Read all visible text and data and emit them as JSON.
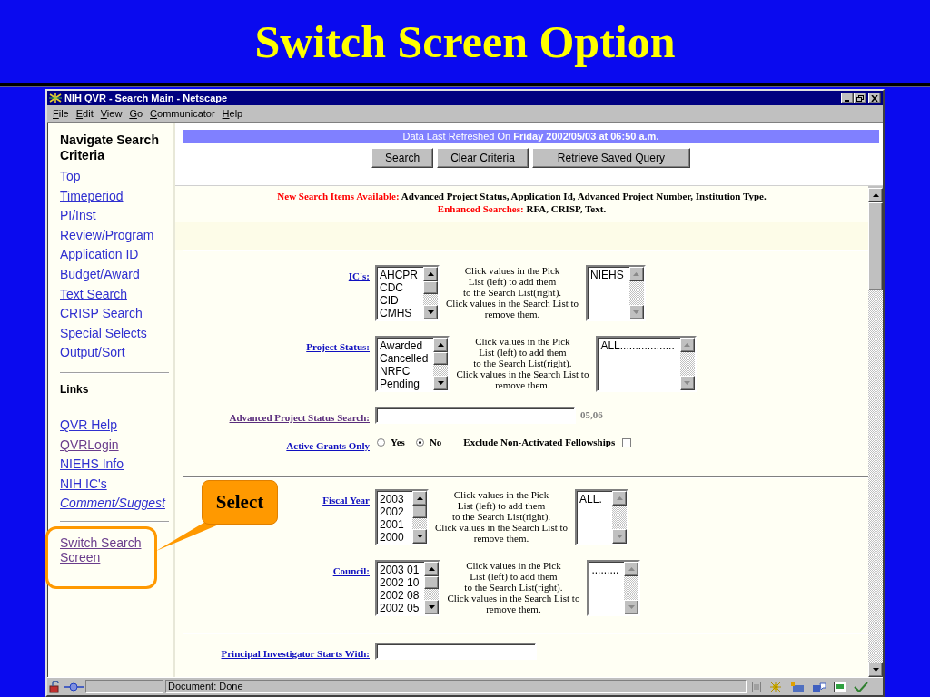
{
  "slide": {
    "title": "Switch Screen Option"
  },
  "window": {
    "title": "NIH QVR - Search Main - Netscape"
  },
  "menu": [
    {
      "label": "File"
    },
    {
      "label": "Edit"
    },
    {
      "label": "View"
    },
    {
      "label": "Go"
    },
    {
      "label": "Communicator"
    },
    {
      "label": "Help"
    }
  ],
  "sidebar": {
    "heading": "Navigate Search Criteria",
    "nav_links": [
      {
        "label": "Top",
        "visited": false
      },
      {
        "label": "Timeperiod",
        "visited": false
      },
      {
        "label": "PI/Inst",
        "visited": false
      },
      {
        "label": "Review/Program",
        "visited": false
      },
      {
        "label": "Application ID",
        "visited": false
      },
      {
        "label": "Budget/Award",
        "visited": false
      },
      {
        "label": "Text Search",
        "visited": false
      },
      {
        "label": "CRISP Search",
        "visited": false
      },
      {
        "label": "Special Selects",
        "visited": false
      },
      {
        "label": "Output/Sort",
        "visited": false
      }
    ],
    "links_heading": "Links",
    "links": [
      {
        "label": "QVR Help",
        "visited": false,
        "italic": false
      },
      {
        "label": "QVRLogin",
        "visited": true,
        "italic": false
      },
      {
        "label": "NIEHS Info",
        "visited": false,
        "italic": false
      },
      {
        "label": "NIH IC's",
        "visited": false,
        "italic": false
      },
      {
        "label": "Comment/Suggest",
        "visited": false,
        "italic": true
      }
    ],
    "switch_link": {
      "label": "Switch Search Screen",
      "visited": true
    }
  },
  "refresh_bar": {
    "text": "Data Last Refreshed On **Friday 2002/05/03 at 06:50 a.m.**"
  },
  "buttons": [
    "Search",
    "Clear Criteria",
    "Retrieve Saved Query"
  ],
  "notices": [
    {
      "label": "New Search Items Available:",
      "text": "Advanced Project Status, Application Id, Advanced Project Number, Institution Type."
    },
    {
      "label": "Enhanced Searches:",
      "text": "RFA, CRISP, Text."
    }
  ],
  "form": {
    "sections": [
      {
        "rows": [
          {
            "kind": "picklist",
            "label": "IC's:",
            "visited": false,
            "pick_list": [
              "AHCPR",
              "CDC",
              "CID",
              "CMHS"
            ],
            "help": "Click values in the Pick\nList (left) to add them\nto the Search List(right).\nClick values in the Search List to\nremove them.",
            "search_list": [
              "NIEHS"
            ]
          },
          {
            "kind": "picklist",
            "label": "Project Status:",
            "visited": false,
            "pick_list": [
              "Awarded",
              "Cancelled",
              "NRFC",
              "Pending"
            ],
            "help": "Click values in the Pick\nList (left) to add them\nto the Search List(right).\nClick values in the Search List to\nremove them.",
            "search_list": [
              "ALL.................."
            ]
          },
          {
            "kind": "text",
            "label": "Advanced Project Status Search:",
            "visited": true,
            "note": "05,06"
          },
          {
            "kind": "radio",
            "label": "Active Grants Only",
            "visited": false,
            "options": [
              {
                "label": "Yes",
                "selected": false
              },
              {
                "label": "No",
                "selected": true
              }
            ],
            "checkbox": {
              "label": "Exclude Non-Activated Fellowships",
              "checked": false
            }
          }
        ]
      },
      {
        "rows": [
          {
            "kind": "picklist",
            "label": "Fiscal Year",
            "visited": false,
            "pick_list": [
              "2003",
              "2002",
              "2001",
              "2000"
            ],
            "help": "Click values in the Pick\nList (left) to add them\nto the Search List(right).\nClick values in the Search List to\nremove them.",
            "search_list": [
              "ALL."
            ]
          },
          {
            "kind": "picklist",
            "label": "Council:",
            "visited": false,
            "pick_list": [
              "2003 01",
              "2002 10",
              "2002 08",
              "2002 05"
            ],
            "help": "Click values in the Pick\nList (left) to add them\nto the Search List(right).\nClick values in the Search List to\nremove them.",
            "search_list": [
              "........."
            ]
          }
        ]
      },
      {
        "rows": [
          {
            "kind": "text",
            "label": "Principal Investigator Starts With:",
            "visited": false
          }
        ]
      }
    ]
  },
  "status_bar": {
    "text": "Document: Done"
  },
  "callout": {
    "label": "Select"
  }
}
